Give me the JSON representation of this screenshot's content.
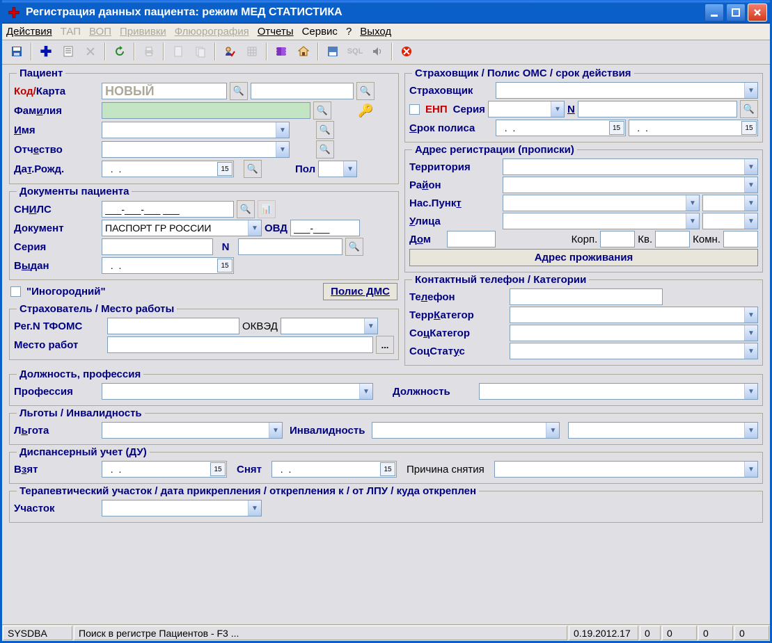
{
  "title": "Регистрация данных пациента: режим МЕД СТАТИСТИКА",
  "menu": {
    "m0": "Действия",
    "m1": "ТАП",
    "m2": "ВОП",
    "m3": "Прививки",
    "m4": "Флюорография",
    "m5": "Отчеты",
    "m6": "Сервис",
    "m7": "?",
    "m8": "Выход"
  },
  "groups": {
    "patient": "Пациент",
    "docs": "Документы пациента",
    "employer": "Страхователь /   Место работы",
    "job": "Должность, профессия",
    "benefit": "Льготы / Инвалидность",
    "disp": "Диспансерный учет (ДУ)",
    "attachment": "Терапевтический участок / дата прикрепления / открепления к / от ЛПУ / куда откреплен",
    "insurer": "Страховщик / Полис ОМС / срок действия",
    "addr": "Адрес регистрации (прописки)",
    "contact": "Контактный телефон   / Категории"
  },
  "patient": {
    "code_label": "Код/",
    "card_label": "Карта",
    "code_value": "НОВЫЙ",
    "lastname_label": "Фамилия",
    "firstname_label": "Имя",
    "middlename_label": "Отчество",
    "dob_label": "Дат.Рожд.",
    "dob_value": "  .  .",
    "gender_label": "Пол"
  },
  "docs": {
    "snils_label": "СНИЛС",
    "snils_value": "___-___-___ ___",
    "doc_label": "Документ",
    "doc_value": "ПАСПОРТ ГР РОССИИ",
    "ovd_label": "ОВД",
    "ovd_value": "___-___",
    "series_label": "Серия",
    "n_label": "N",
    "issued_label": "Выдан",
    "issued_value": "  .  .",
    "foreign_label": "\"Иногородний\"",
    "polis_dms_btn": "Полис ДМС"
  },
  "employer": {
    "reg_label": "Рег.N ТФОМС",
    "okved_label": "ОКВЭД",
    "workplace_label": "Место работ",
    "lookup_btn": "..."
  },
  "job": {
    "profession_label": "Профессия",
    "position_label": "Должность"
  },
  "benefit": {
    "benefit_label": "Льгота",
    "invalid_label": "Инвалидность"
  },
  "disp": {
    "taken_label": "Взят",
    "taken_value": "  .  .",
    "removed_label": "Снят",
    "removed_value": "  .  .",
    "reason_label": "Причина снятия"
  },
  "attachment": {
    "section_label": "Участок"
  },
  "insurer": {
    "insurer_label": "Страховщик",
    "enp_label": "ЕНП",
    "series_label": "Серия",
    "n_label": "N",
    "term_label": "Срок полиса",
    "term_from": "  .  .",
    "term_to": "  .  .",
    "addr_btn": "Адрес проживания"
  },
  "addr": {
    "territory_label": "Территория",
    "district_label": "Район",
    "locality_label": "Нас.Пункт",
    "street_label": "Улица",
    "house_label": "Дом",
    "korp_label": "Корп.",
    "kv_label": "Кв.",
    "room_label": "Комн."
  },
  "contact": {
    "phone_label": "Телефон",
    "terrcat_label": "ТеррКатегор",
    "soccat_label": "СоцКатегор",
    "socstat_label": "СоцСтатус"
  },
  "status": {
    "user": "SYSDBA",
    "hint": "Поиск в регистре Пациентов - F3 ...",
    "ver": "0.19.2012.17",
    "s1": "0",
    "s2": "0",
    "s3": "0",
    "s4": "0"
  }
}
